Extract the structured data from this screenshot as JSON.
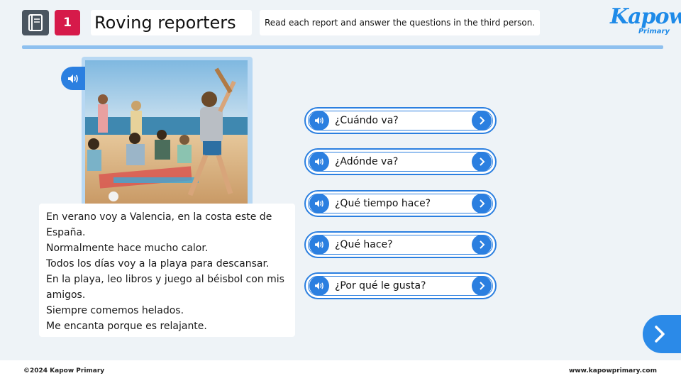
{
  "header": {
    "lesson_number": "1",
    "title": "Roving reporters",
    "instruction": "Read each report and answer the questions in the third person."
  },
  "brand": {
    "logo_main": "Kapow",
    "logo_sub": "Primary",
    "accent_color": "#2b7fe0",
    "number_badge_color": "#d61a4a"
  },
  "report": {
    "lines": [
      "En verano voy a Valencia, en la costa este de",
      "España.",
      "Normalmente hace mucho calor.",
      "Todos los días voy a la playa para descansar.",
      "En la playa, leo libros y juego al béisbol con mis",
      "amigos.",
      "Siempre comemos helados.",
      "Me encanta porque es relajante."
    ]
  },
  "questions": [
    {
      "text": "¿Cuándo va?"
    },
    {
      "text": "¿Adónde va?"
    },
    {
      "text": "¿Qué tiempo hace?"
    },
    {
      "text": "¿Qué hace?"
    },
    {
      "text": "¿Por qué le gusta?"
    }
  ],
  "footer": {
    "copyright": "©2024 Kapow Primary",
    "website": "www.kapowprimary.com"
  }
}
